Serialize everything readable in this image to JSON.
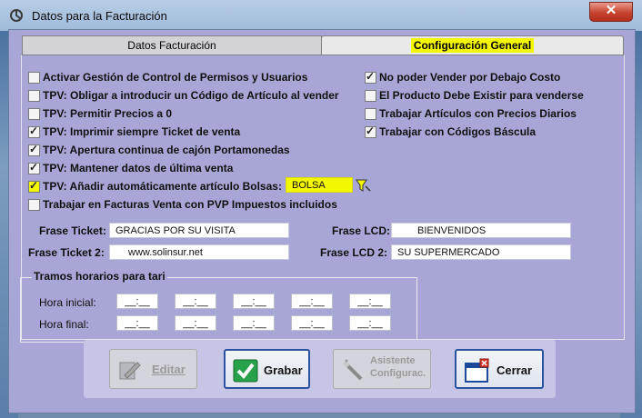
{
  "window": {
    "title": "Datos para la Facturación",
    "close_symbol": "✕"
  },
  "tabs": [
    {
      "label": "Datos Facturación"
    },
    {
      "label": "Configuración General"
    }
  ],
  "left_checks": [
    {
      "label": "Activar Gestión de Control de Permisos y Usuarios",
      "checked": false
    },
    {
      "label": "TPV: Obligar a introducir un Código de Artículo al vender",
      "checked": false
    },
    {
      "label": "TPV: Permitir Precios a 0",
      "checked": false
    },
    {
      "label": "TPV: Imprimir siempre Ticket de venta",
      "checked": true
    },
    {
      "label": "TPV: Apertura continua de cajón Portamonedas",
      "checked": true
    },
    {
      "label": "TPV: Mantener datos de última venta",
      "checked": true
    },
    {
      "label": "TPV: Añadir automáticamente artículo Bolsas:",
      "checked": true
    },
    {
      "label": "Trabajar en Facturas Venta con PVP Impuestos incluidos",
      "checked": false
    }
  ],
  "right_checks": [
    {
      "label": "No poder Vender por Debajo Costo",
      "checked": true
    },
    {
      "label": "El Producto Debe Existir para venderse",
      "checked": false
    },
    {
      "label": "Trabajar Artículos con Precios Diarios",
      "checked": false
    },
    {
      "label": "Trabajar con Códigos Báscula",
      "checked": true
    }
  ],
  "bolsa_value": "BOLSA",
  "frases": {
    "ticket_label": "Frase Ticket:",
    "ticket_value": "GRACIAS POR SU VISITA",
    "ticket2_label": "Frase Ticket 2:",
    "ticket2_value": "www.solinsur.net",
    "lcd_label": "Frase LCD:",
    "lcd_value": "BIENVENIDOS",
    "lcd2_label": "Frase LCD 2:",
    "lcd2_value": "SU SUPERMERCADO"
  },
  "tramos": {
    "title": "Tramos horarios para tari",
    "inicial_label": "Hora inicial:",
    "final_label": "Hora final:",
    "slot": "__:__"
  },
  "buttons": {
    "editar": "Editar",
    "grabar": "Grabar",
    "asistente_1": "Asistente",
    "asistente_2": "Configurac.",
    "cerrar": "Cerrar"
  },
  "colors": {
    "highlight": "#f3f700",
    "client_bg": "#a7a6d6"
  }
}
